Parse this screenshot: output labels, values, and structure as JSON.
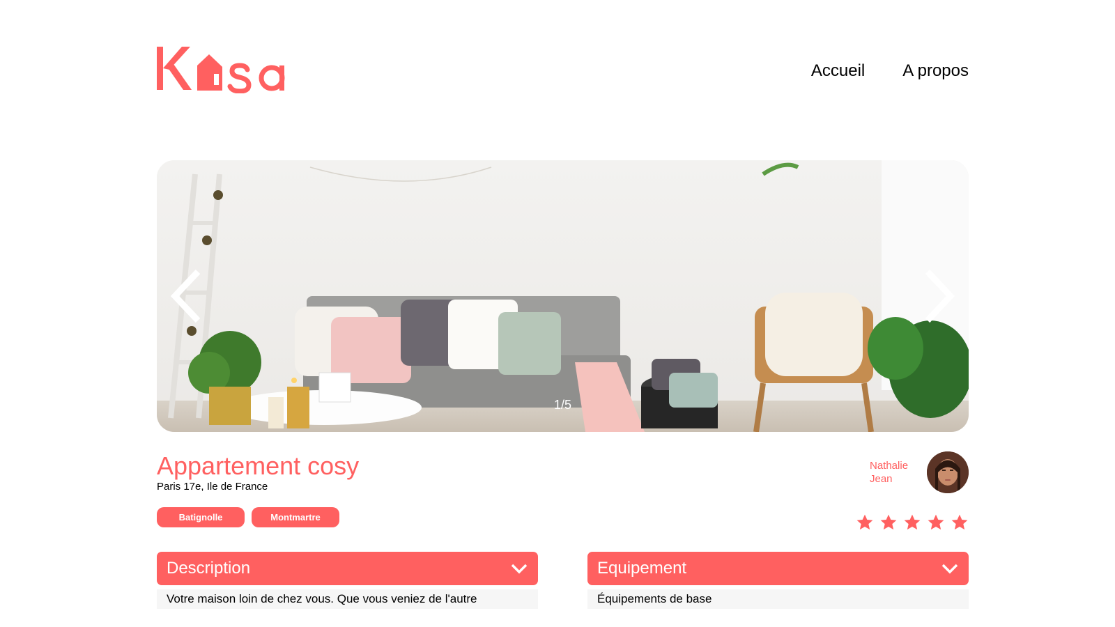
{
  "brand": {
    "name": "Kasa",
    "accent": "#FF6060"
  },
  "nav": {
    "items": [
      {
        "label": "Accueil"
      },
      {
        "label": "A propos"
      }
    ]
  },
  "carousel": {
    "counter": "1/5",
    "prev_icon": "chevron-left-icon",
    "next_icon": "chevron-right-icon"
  },
  "listing": {
    "title": "Appartement cosy",
    "location": "Paris 17e, Ile de France",
    "tags": [
      "Batignolle",
      "Montmartre"
    ],
    "rating": 5,
    "rating_max": 5
  },
  "host": {
    "first_name": "Nathalie",
    "last_name": "Jean"
  },
  "collapses": [
    {
      "title": "Description",
      "content": "Votre maison loin de chez vous. Que vous veniez de l'autre",
      "icon": "chevron-down-icon"
    },
    {
      "title": "Equipement",
      "content": "Équipements de base",
      "icon": "chevron-down-icon"
    }
  ]
}
